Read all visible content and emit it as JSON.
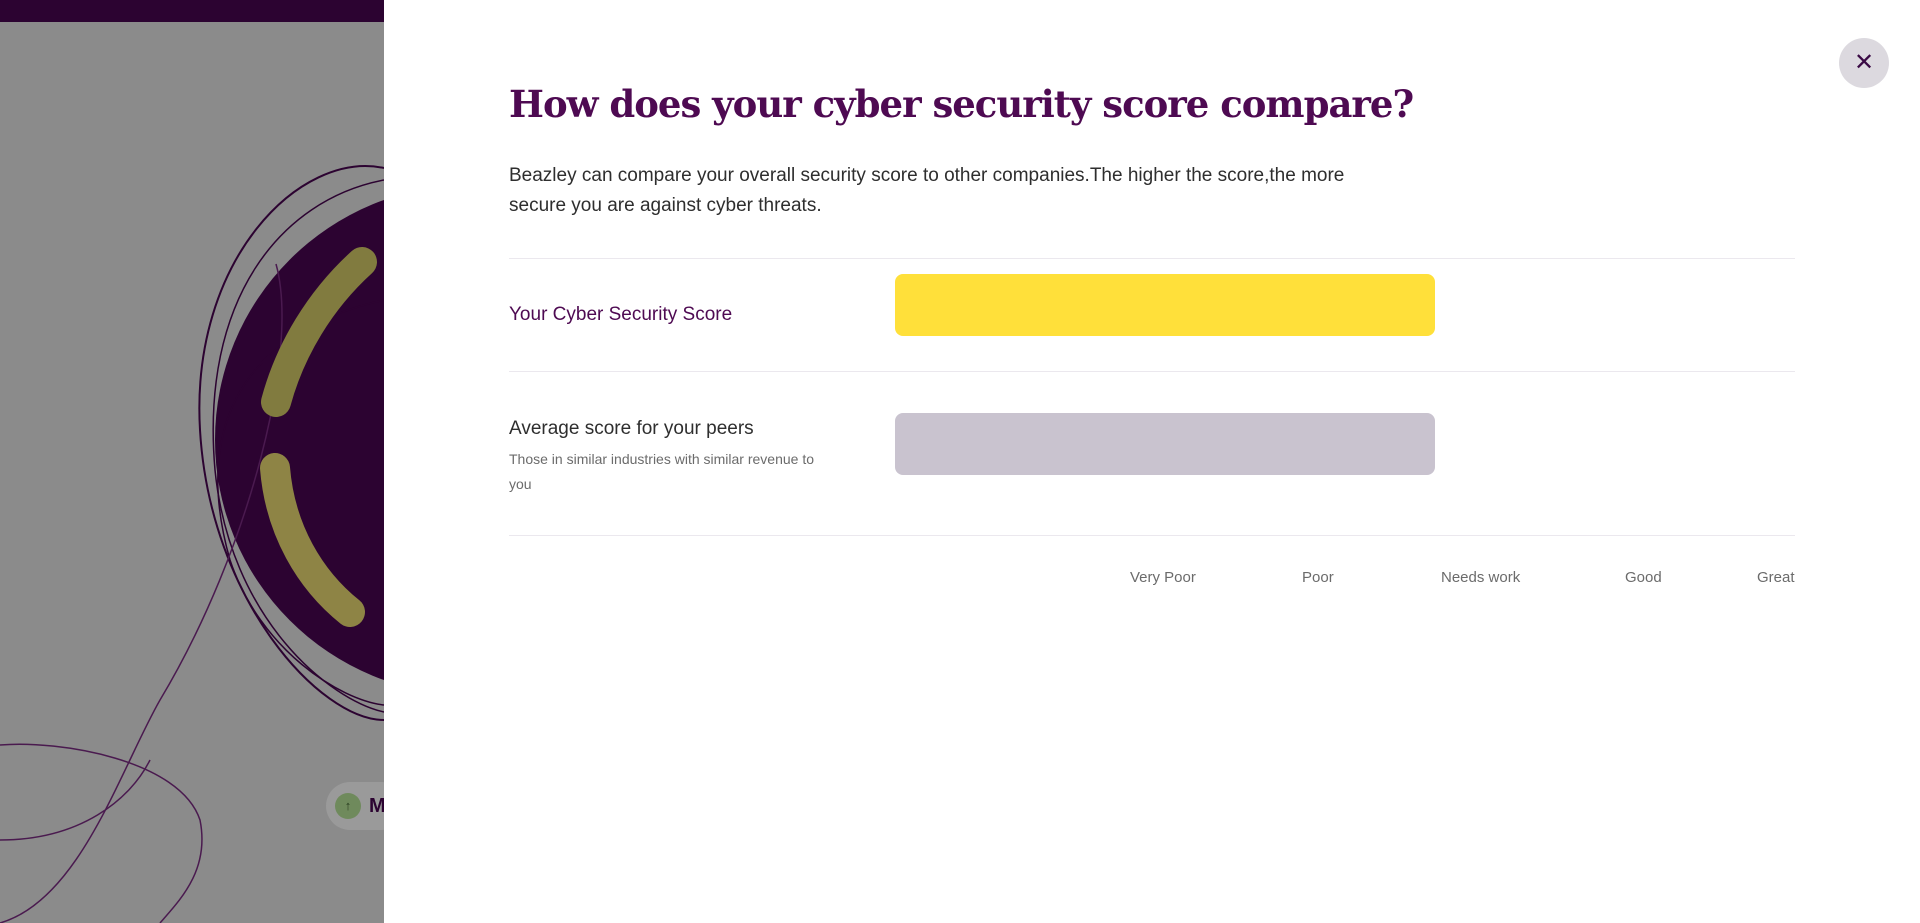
{
  "modal": {
    "close_icon": "close-icon",
    "title": "How does your cyber security score compare?",
    "description": "Beazley can compare your overall security score to other companies.The higher the score,the more secure you are against cyber threats.",
    "your_score": {
      "label": "Your Cyber Security Score",
      "bar_color": "#FFE03A",
      "fill_fraction": 1.0
    },
    "peer_score": {
      "label": "Average score for your peers",
      "sublabel": "Those in similar industries with similar revenue to you",
      "bar_color": "#C9C3CF",
      "fill_fraction": 1.0
    },
    "scale": [
      "Very Poor",
      "Poor",
      "Needs work",
      "Good",
      "Great"
    ]
  },
  "background": {
    "brand_color": "#2C0331",
    "chip_icon": "arrow-up-icon",
    "chip_text": "M"
  }
}
